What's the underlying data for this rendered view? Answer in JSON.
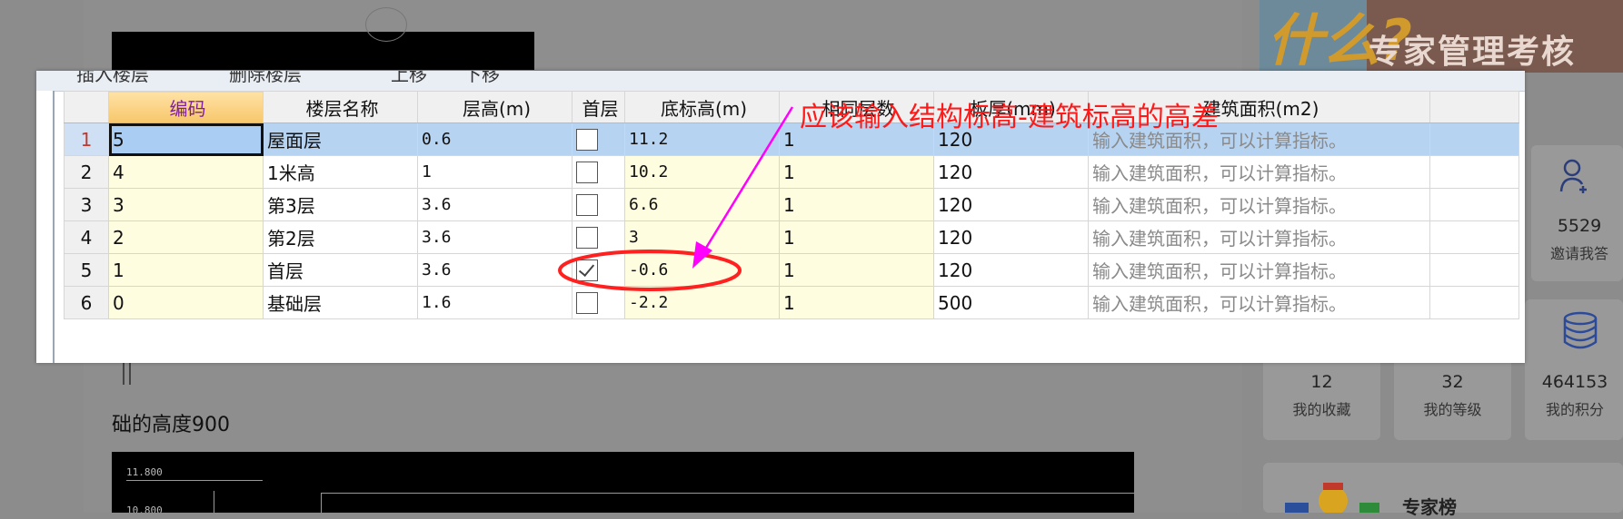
{
  "background": {
    "text_line": "础的高度900",
    "drawing_labels": [
      "11.800",
      "10.800"
    ],
    "sidebar": {
      "banner_title": "专家管理考核",
      "banner_mark": "什么?",
      "invite": {
        "count": "5529",
        "label": "邀请我答"
      },
      "stats": [
        {
          "count": "12",
          "label": "我的收藏"
        },
        {
          "count": "32",
          "label": "我的等级"
        },
        {
          "count": "464153",
          "label": "我的积分"
        }
      ],
      "expert_title": "专家榜"
    }
  },
  "toolbar": {
    "items": [
      "插入楼层",
      "删除楼层",
      "上移",
      "下移"
    ]
  },
  "grid": {
    "columns": [
      "编码",
      "楼层名称",
      "层高(m)",
      "首层",
      "底标高(m)",
      "相同层数",
      "板厚(mm)",
      "建筑面积(m2)"
    ],
    "rows": [
      {
        "no": "1",
        "code": "5",
        "name": "屋面层",
        "height": "0.6",
        "first": false,
        "base": "11.2",
        "same": "1",
        "slab": "120",
        "area": "输入建筑面积，可以计算指标。"
      },
      {
        "no": "2",
        "code": "4",
        "name": "1米高",
        "height": "1",
        "first": false,
        "base": "10.2",
        "same": "1",
        "slab": "120",
        "area": "输入建筑面积，可以计算指标。"
      },
      {
        "no": "3",
        "code": "3",
        "name": "第3层",
        "height": "3.6",
        "first": false,
        "base": "6.6",
        "same": "1",
        "slab": "120",
        "area": "输入建筑面积，可以计算指标。"
      },
      {
        "no": "4",
        "code": "2",
        "name": "第2层",
        "height": "3.6",
        "first": false,
        "base": "3",
        "same": "1",
        "slab": "120",
        "area": "输入建筑面积，可以计算指标。"
      },
      {
        "no": "5",
        "code": "1",
        "name": "首层",
        "height": "3.6",
        "first": true,
        "base": "-0.6",
        "same": "1",
        "slab": "120",
        "area": "输入建筑面积，可以计算指标。"
      },
      {
        "no": "6",
        "code": "0",
        "name": "基础层",
        "height": "1.6",
        "first": false,
        "base": "-2.2",
        "same": "1",
        "slab": "500",
        "area": "输入建筑面积，可以计算指标。"
      }
    ]
  },
  "annotation": {
    "text": "应该输入结构标高-建筑标高的高差",
    "color": "#ff1a1a",
    "arrow_color": "#ff00ff"
  }
}
